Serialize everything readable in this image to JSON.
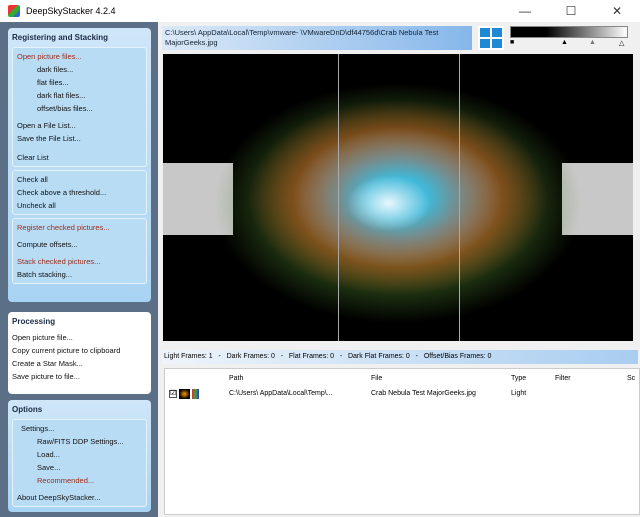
{
  "window": {
    "title": "DeepSkyStacker 4.2.4",
    "minimize": "—",
    "maximize": "☐",
    "close": "✕"
  },
  "sidebar": {
    "registering": {
      "title": "Registering and Stacking",
      "items": [
        "Open picture files...",
        "dark files...",
        "flat files...",
        "dark flat files...",
        "offset/bias files...",
        "Open a File List...",
        "Save the File List...",
        "Clear List",
        "Check all",
        "Check above a threshold...",
        "Uncheck all",
        "Register checked pictures...",
        "Compute offsets...",
        "Stack checked pictures...",
        "Batch stacking..."
      ]
    },
    "processing": {
      "title": "Processing",
      "items": [
        "Open picture file...",
        "Copy current picture to clipboard",
        "Create a Star Mask...",
        "Save picture to file..."
      ]
    },
    "options": {
      "title": "Options",
      "items": [
        "Settings...",
        "Raw/FITS DDP Settings...",
        "Load...",
        "Save...",
        "Recommended...",
        "About DeepSkyStacker..."
      ]
    }
  },
  "main": {
    "path": "C:\\Users\\        AppData\\Local\\Temp\\vmware-        \\VMwareDnD\\df44756d\\Crab Nebula Test MajorGeeks.jpg",
    "stats": "Light Frames: 1   -   Dark Frames: 0   -   Flat Frames: 0   -   Dark Flat Frames: 0   -   Offset/Bias Frames: 0",
    "table": {
      "headers": [
        "Path",
        "File",
        "Type",
        "Filter",
        "Sc"
      ],
      "rows": [
        {
          "checked": "☑",
          "path": "C:\\Users\\    AppData\\Local\\Temp\\...",
          "file": "Crab Nebula Test MajorGeeks.jpg",
          "type": "Light",
          "filter": ""
        }
      ]
    }
  }
}
